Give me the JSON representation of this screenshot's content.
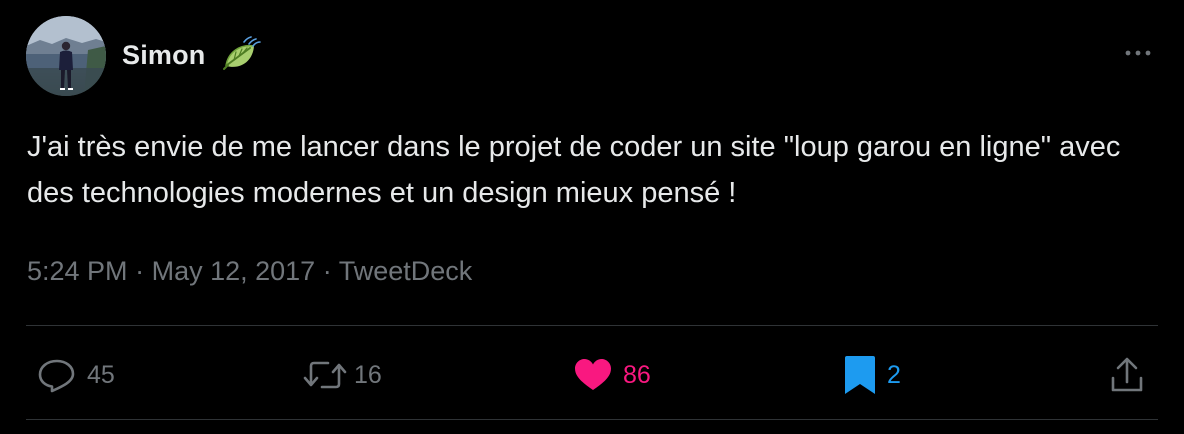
{
  "author": {
    "name": "Simon",
    "badge_icon": "leaf-emoji"
  },
  "tweet": {
    "text": "J'ai très envie de me lancer dans le projet de coder un site \"loup garou en ligne\" avec des technologies modernes et un design mieux pensé !",
    "time": "5:24 PM",
    "separator": "·",
    "date": "May 12, 2017",
    "source": "TweetDeck"
  },
  "actions": {
    "replies": {
      "icon": "reply-icon",
      "count": "45",
      "color": "#71767b"
    },
    "retweets": {
      "icon": "retweet-icon",
      "count": "16",
      "color": "#71767b"
    },
    "likes": {
      "icon": "heart-icon",
      "count": "86",
      "color": "#f91880"
    },
    "bookmarks": {
      "icon": "bookmark-icon",
      "count": "2",
      "color": "#1d9bf0"
    },
    "share": {
      "icon": "share-icon"
    }
  },
  "colors": {
    "background": "#000000",
    "text": "#e7e9ea",
    "secondary": "#71767b",
    "divider": "#2f3336"
  }
}
